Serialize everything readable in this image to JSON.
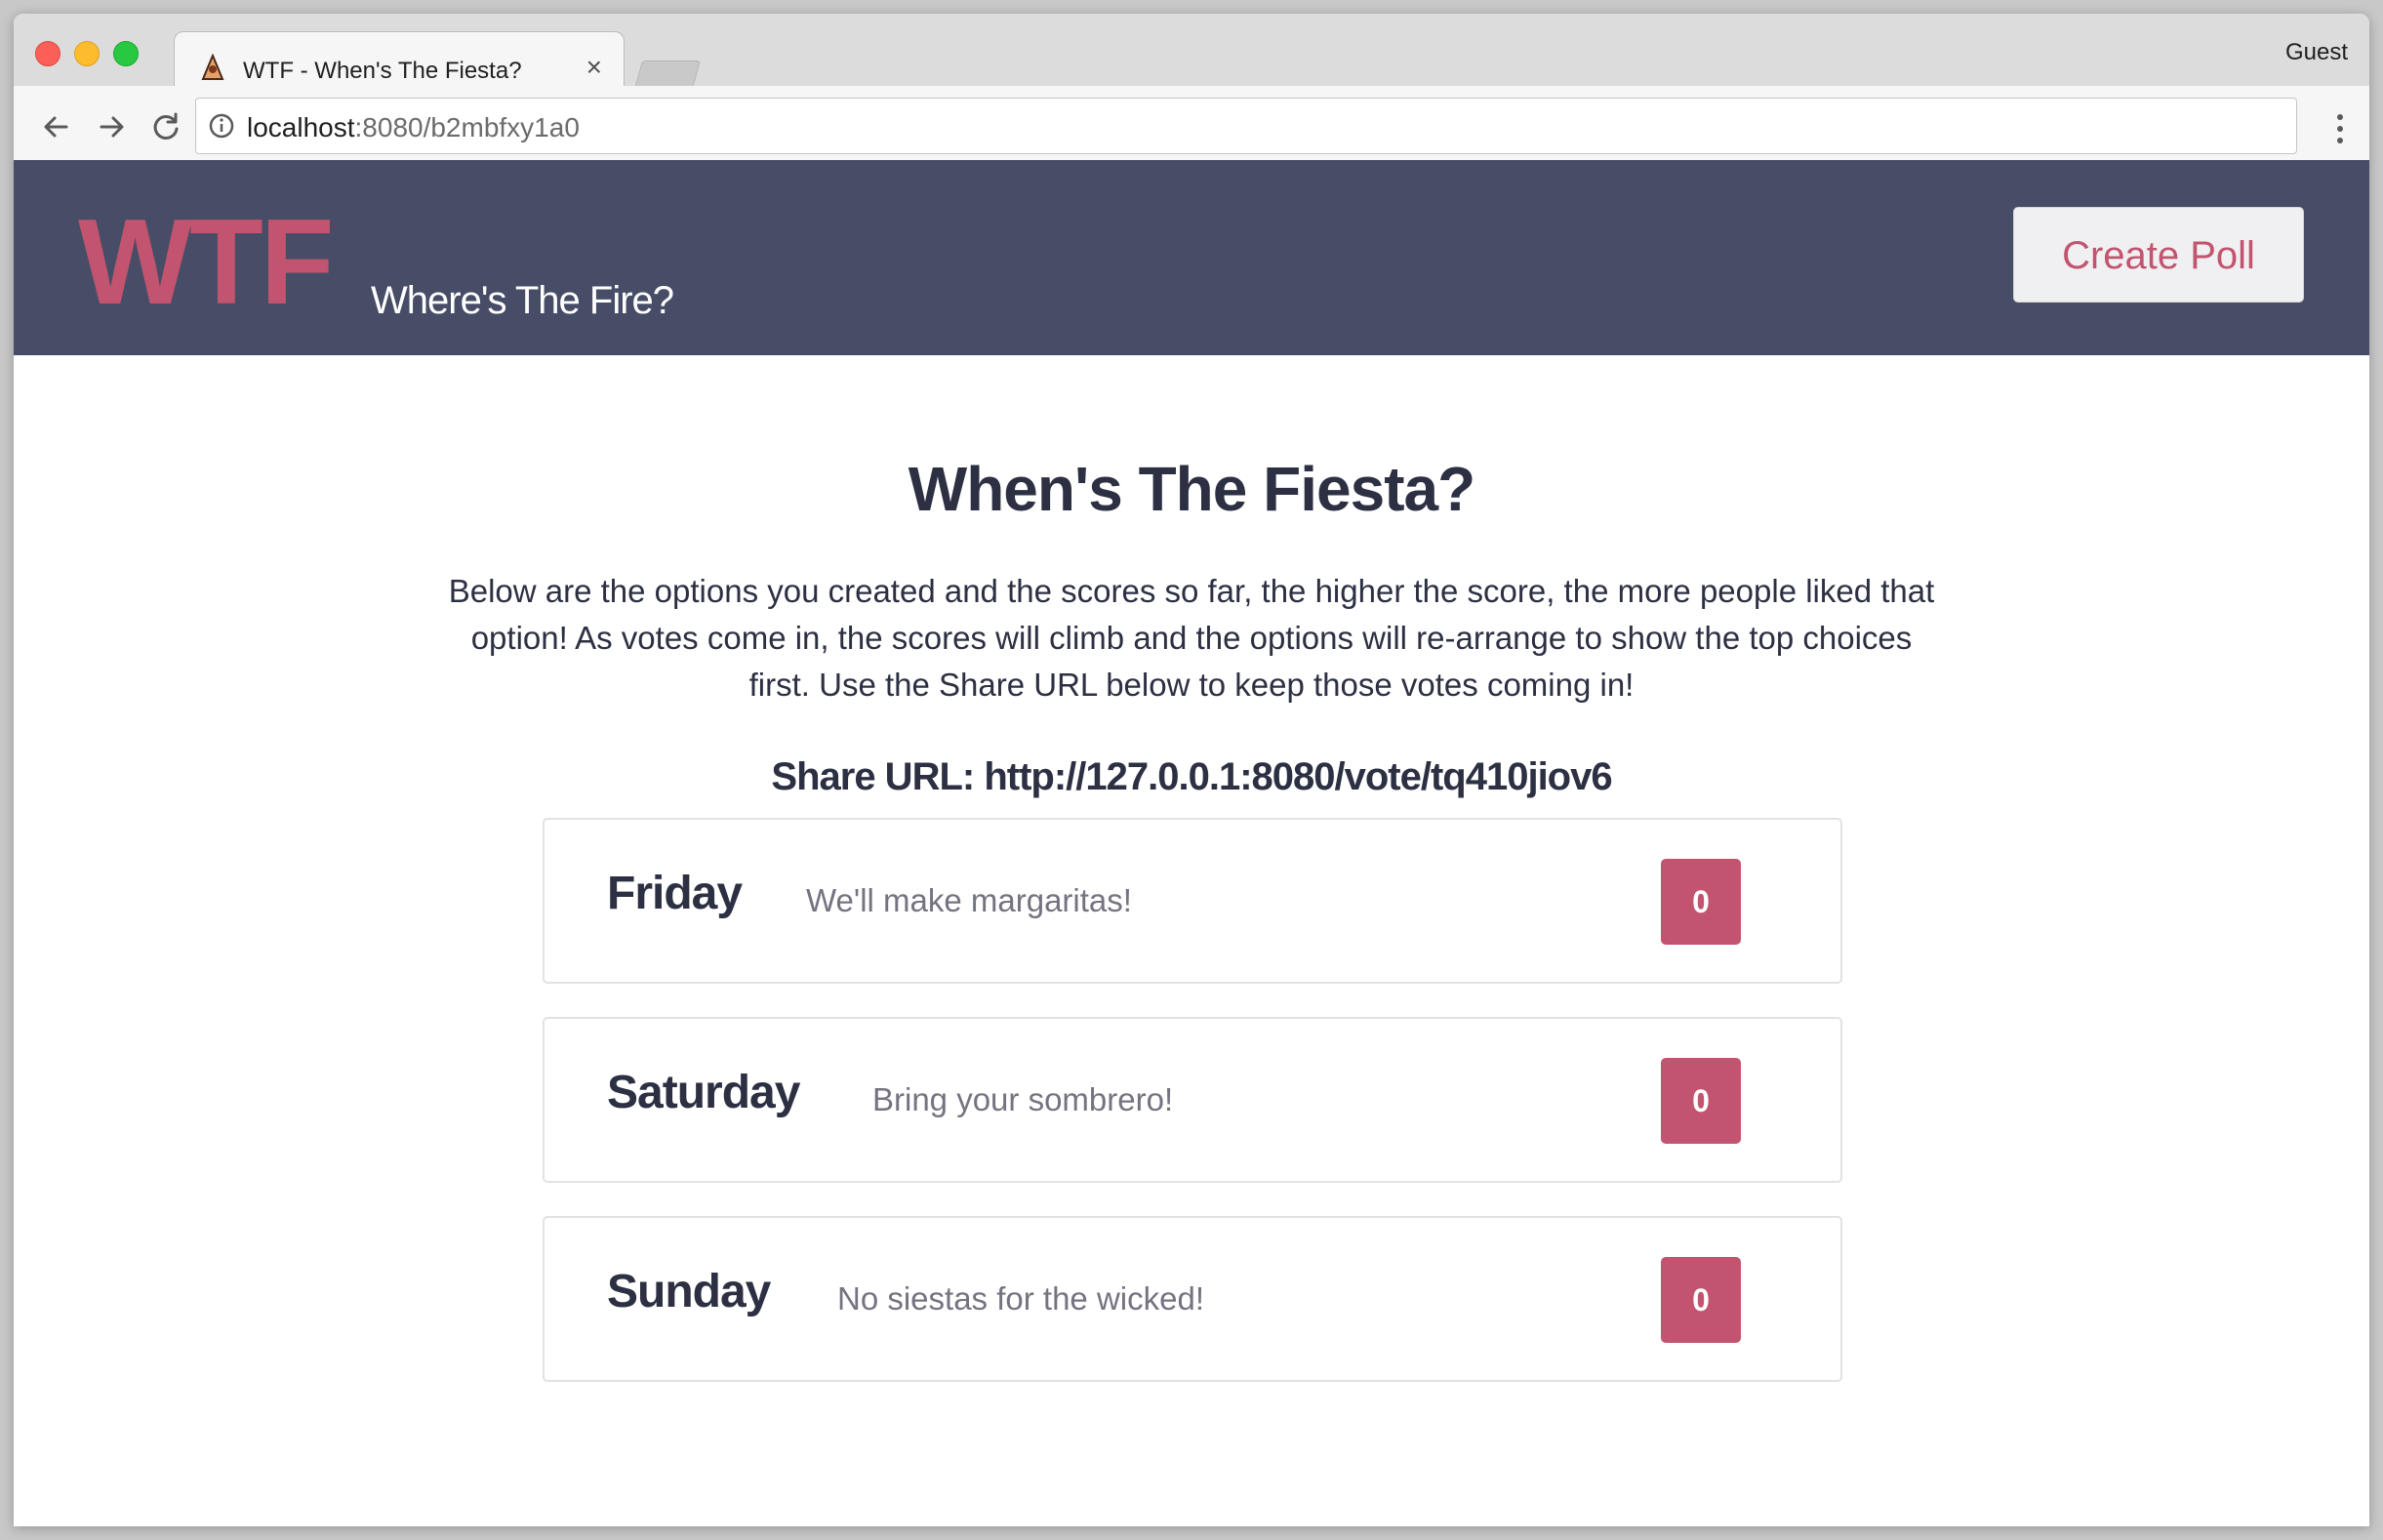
{
  "browser": {
    "tab_title": "WTF - When's The Fiesta?",
    "tab_close": "×",
    "profile": "Guest",
    "url_host": "localhost",
    "url_rest": ":8080/b2mbfxy1a0",
    "icons": [
      "back-icon",
      "forward-icon",
      "reload-icon",
      "info-icon",
      "menu-icon",
      "favicon"
    ]
  },
  "header": {
    "logo": "WTF",
    "tagline": "Where's The Fire?",
    "create_button": "Create Poll"
  },
  "main": {
    "title": "When's The Fiesta?",
    "intro": "Below are the options you created and the scores so far, the higher the score, the more people liked that option! As votes come in, the scores will climb and the options will re-arrange to show the top choices first. Use the Share URL below to keep those votes coming in!",
    "share_url": "Share URL: http://127.0.0.1:8080/vote/tq410jiov6",
    "options": [
      {
        "day": "Friday",
        "note": "We'll make margaritas!",
        "score": "0"
      },
      {
        "day": "Saturday",
        "note": "Bring your sombrero!",
        "score": "0"
      },
      {
        "day": "Sunday",
        "note": "No siestas for the wicked!",
        "score": "0"
      }
    ]
  },
  "colors": {
    "header_bg": "#474d66",
    "accent": "#c2546f",
    "text_dark": "#2c3042",
    "text_muted": "#737480"
  }
}
